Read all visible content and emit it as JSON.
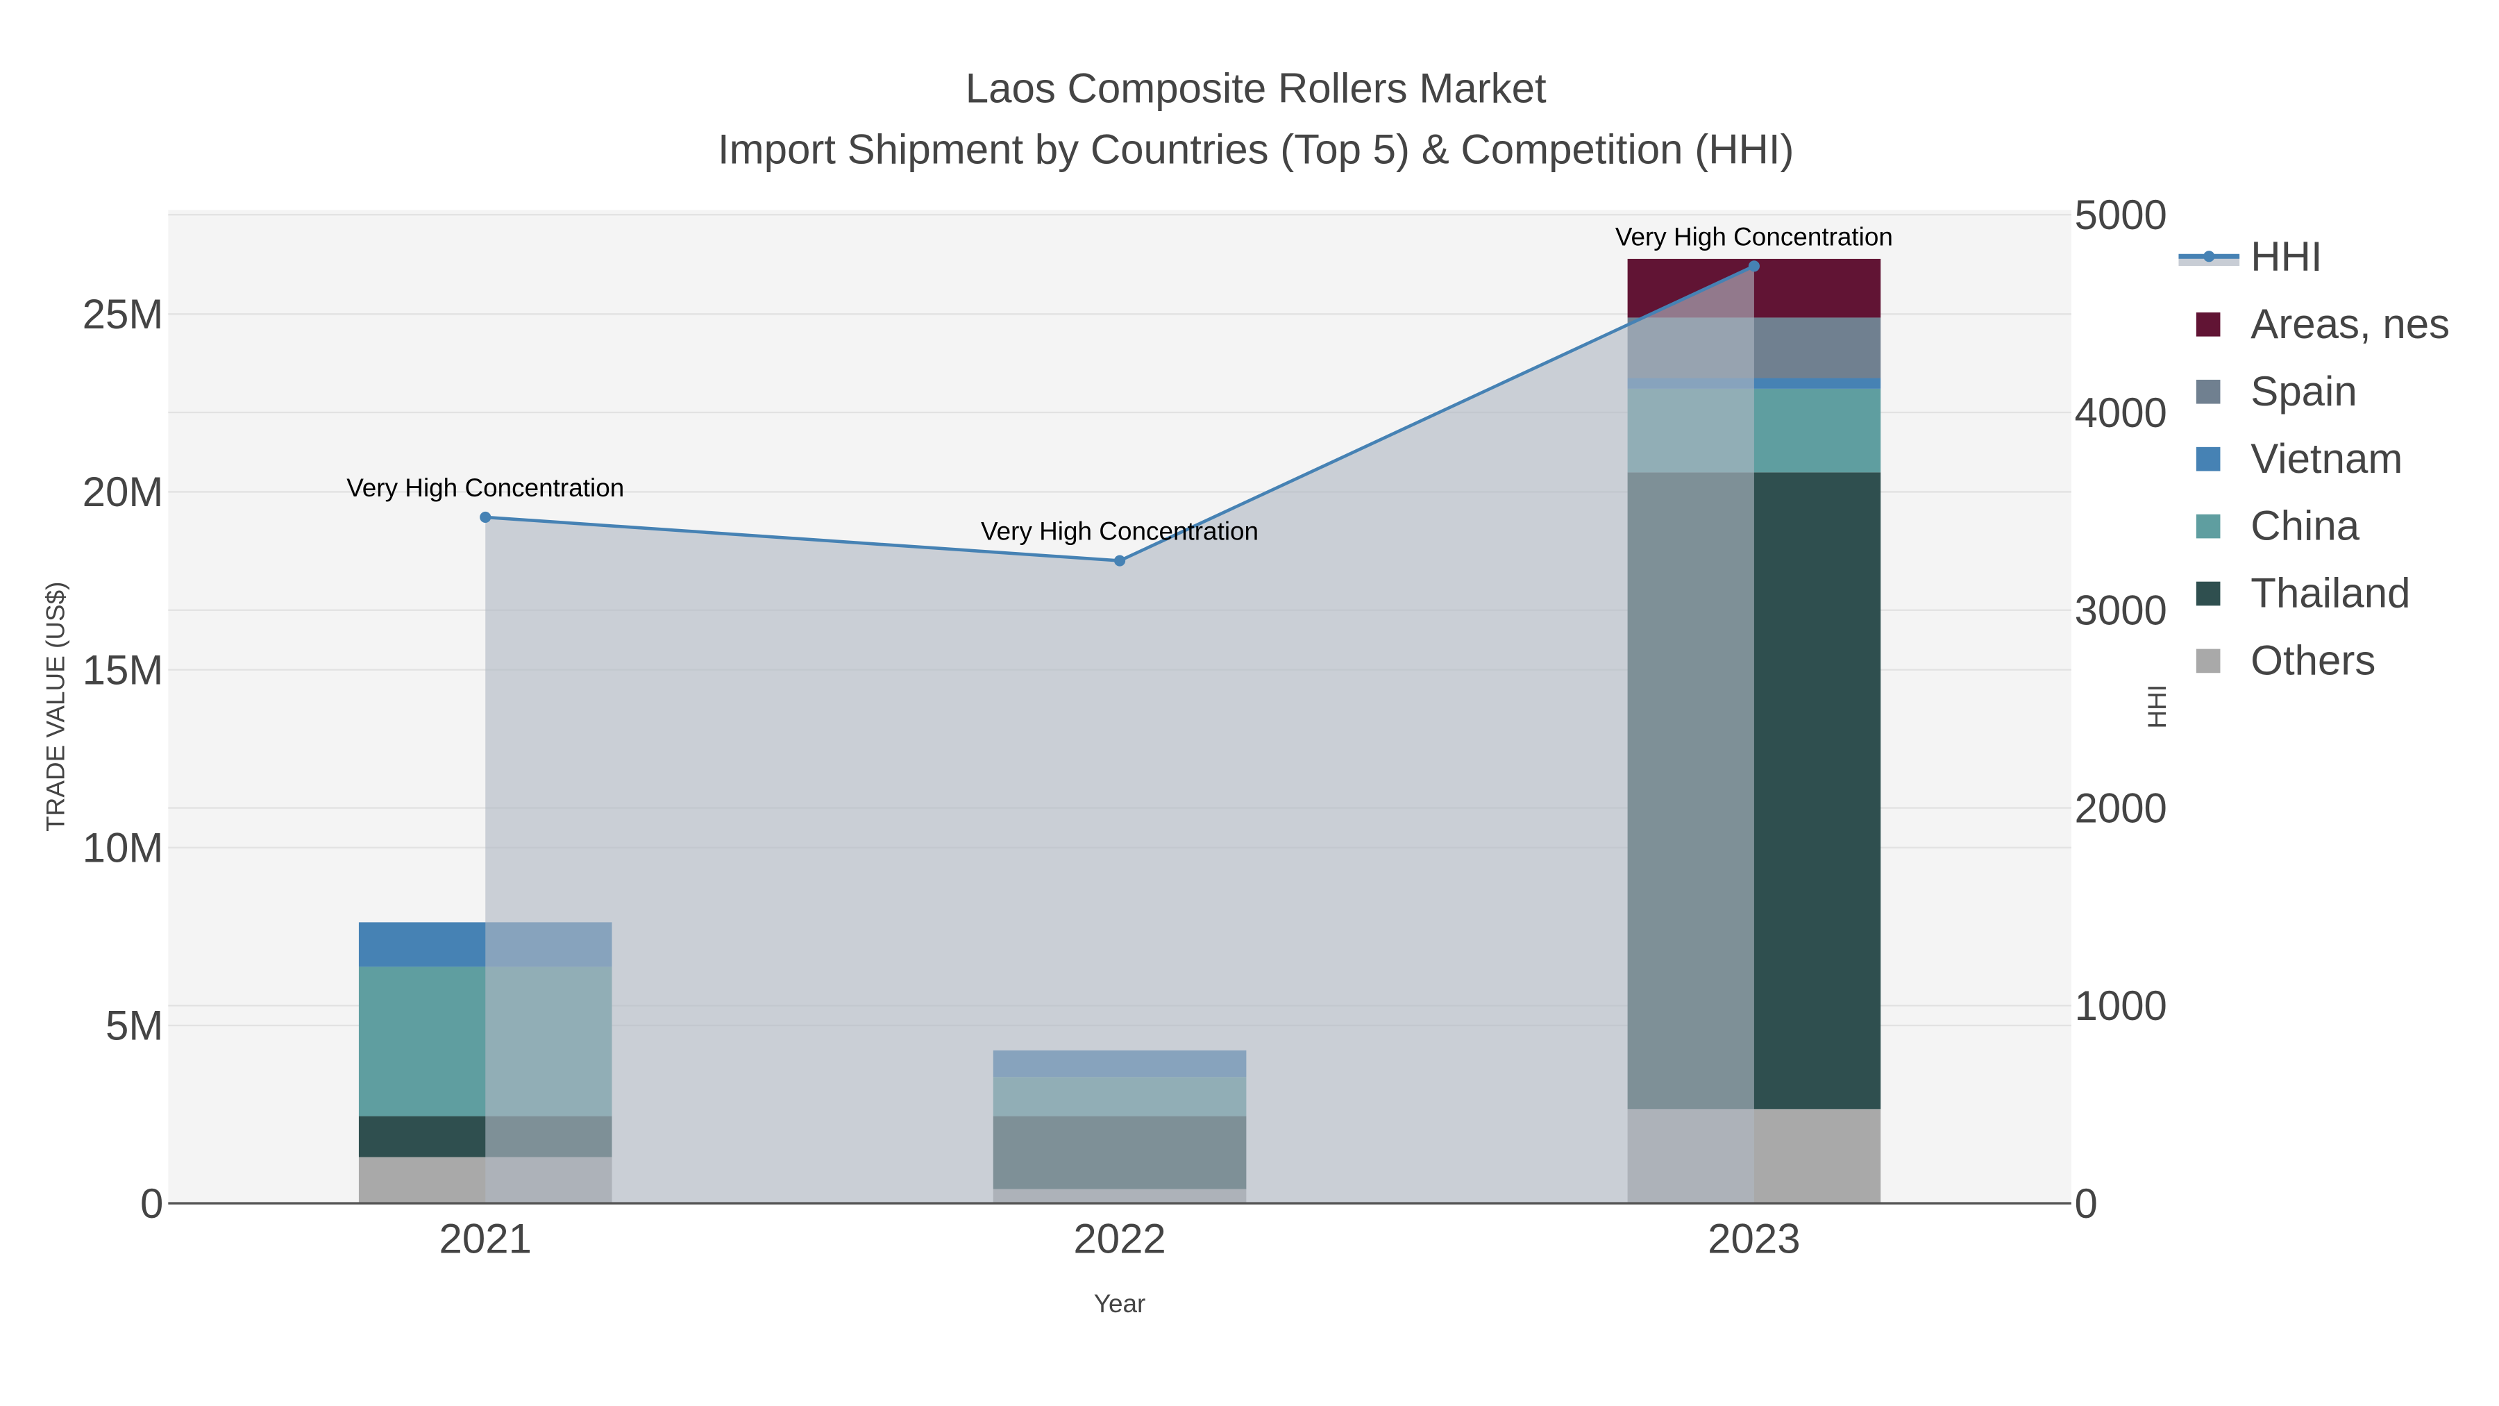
{
  "chart_data": {
    "type": "bar",
    "title": "Laos Composite Rollers Market",
    "subtitle": "Import Shipment by Countries (Top 5) & Competition (HHI)",
    "xlabel": "Year",
    "ylabel": "TRADE VALUE (US$)",
    "y2label": "HHI",
    "categories": [
      "2021",
      "2022",
      "2023"
    ],
    "ylim": [
      0,
      28000000
    ],
    "y2lim": [
      0,
      5000
    ],
    "yticks": [
      {
        "v": 0,
        "label": "0"
      },
      {
        "v": 5000000,
        "label": "5M"
      },
      {
        "v": 10000000,
        "label": "10M"
      },
      {
        "v": 15000000,
        "label": "15M"
      },
      {
        "v": 20000000,
        "label": "20M"
      },
      {
        "v": 25000000,
        "label": "25M"
      }
    ],
    "y2ticks": [
      {
        "v": 0,
        "label": "0"
      },
      {
        "v": 1000,
        "label": "1000"
      },
      {
        "v": 2000,
        "label": "2000"
      },
      {
        "v": 3000,
        "label": "3000"
      },
      {
        "v": 4000,
        "label": "4000"
      },
      {
        "v": 5000,
        "label": "5000"
      }
    ],
    "stacked": true,
    "series": [
      {
        "name": "Others",
        "color": "#a9a9a9",
        "values": [
          1300000,
          400000,
          2650000
        ]
      },
      {
        "name": "Thailand",
        "color": "#2f4f4f",
        "values": [
          1150000,
          2050000,
          17900000
        ]
      },
      {
        "name": "China",
        "color": "#5f9ea0",
        "values": [
          4200000,
          1100000,
          2350000
        ]
      },
      {
        "name": "Vietnam",
        "color": "#4682b4",
        "values": [
          1250000,
          750000,
          300000
        ]
      },
      {
        "name": "Spain",
        "color": "#708090",
        "values": [
          0,
          0,
          1700000
        ]
      },
      {
        "name": "Areas, nes",
        "color": "#611434",
        "values": [
          0,
          0,
          1650000
        ]
      }
    ],
    "line": {
      "name": "HHI",
      "color": "#4682b4",
      "axis": "y2",
      "values": [
        3470,
        3250,
        4740
      ],
      "annotations": [
        "Very High Concentration",
        "Very High Concentration",
        "Very High Concentration"
      ]
    },
    "legend_order": [
      "HHI",
      "Areas, nes",
      "Spain",
      "Vietnam",
      "China",
      "Thailand",
      "Others"
    ],
    "legend_position": "right",
    "grid": true
  }
}
